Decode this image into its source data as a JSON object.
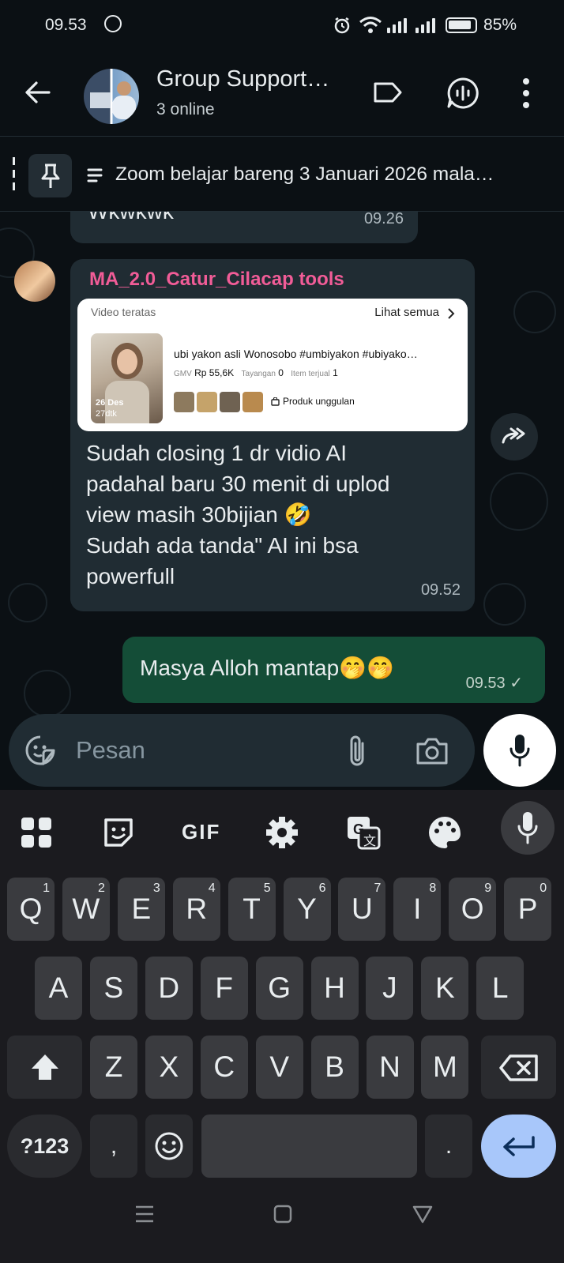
{
  "status_bar": {
    "time": "09.53",
    "battery": "85%"
  },
  "header": {
    "title": "Group Support…",
    "subtitle": "3 online"
  },
  "pinned": {
    "text": "Zoom belajar bareng 3 Januari 2026 mala…"
  },
  "messages": {
    "prev": {
      "text": "Wkwkwk",
      "time": "09.26"
    },
    "incoming": {
      "sender": "MA_2.0_Catur_Cilacap tools",
      "card": {
        "label": "Video teratas",
        "link": "Lihat semua",
        "video_title": "ubi yakon asli Wonosobo #umbiyakon #ubiyako…",
        "gmv_label": "GMV",
        "gmv_value": "Rp 55,6K",
        "views_label": "Tayangan",
        "views_value": "0",
        "items_label": "Item terjual",
        "items_value": "1",
        "thumb_date": "26 Des",
        "thumb_duration": "27dtk",
        "badge": "Produk unggulan"
      },
      "lines": [
        "Sudah closing 1 dr vidio AI",
        "padahal baru 30 menit di uplod",
        "view masih 30bijian 🤣",
        "Sudah ada tanda\" AI ini bsa",
        "powerfull"
      ],
      "time": "09.52"
    },
    "outgoing": {
      "text": "Masya Alloh mantap🤭🤭",
      "time": "09.53 ✓"
    }
  },
  "input": {
    "placeholder": "Pesan"
  },
  "keyboard": {
    "tools": [
      "apps-icon",
      "sticker-icon",
      "GIF",
      "settings-icon",
      "translate-icon",
      "palette-icon",
      "mic-icon"
    ],
    "row1": [
      {
        "k": "Q",
        "n": "1"
      },
      {
        "k": "W",
        "n": "2"
      },
      {
        "k": "E",
        "n": "3"
      },
      {
        "k": "R",
        "n": "4"
      },
      {
        "k": "T",
        "n": "5"
      },
      {
        "k": "Y",
        "n": "6"
      },
      {
        "k": "U",
        "n": "7"
      },
      {
        "k": "I",
        "n": "8"
      },
      {
        "k": "O",
        "n": "9"
      },
      {
        "k": "P",
        "n": "0"
      }
    ],
    "row2": [
      "A",
      "S",
      "D",
      "F",
      "G",
      "H",
      "J",
      "K",
      "L"
    ],
    "row3": [
      "Z",
      "X",
      "C",
      "V",
      "B",
      "N",
      "M"
    ],
    "symbols": "?123",
    "comma": ",",
    "period": "."
  },
  "colors": {
    "accent_green": "#144d37",
    "sender_pink": "#f15c97",
    "enter_blue": "#a8c7fa"
  }
}
